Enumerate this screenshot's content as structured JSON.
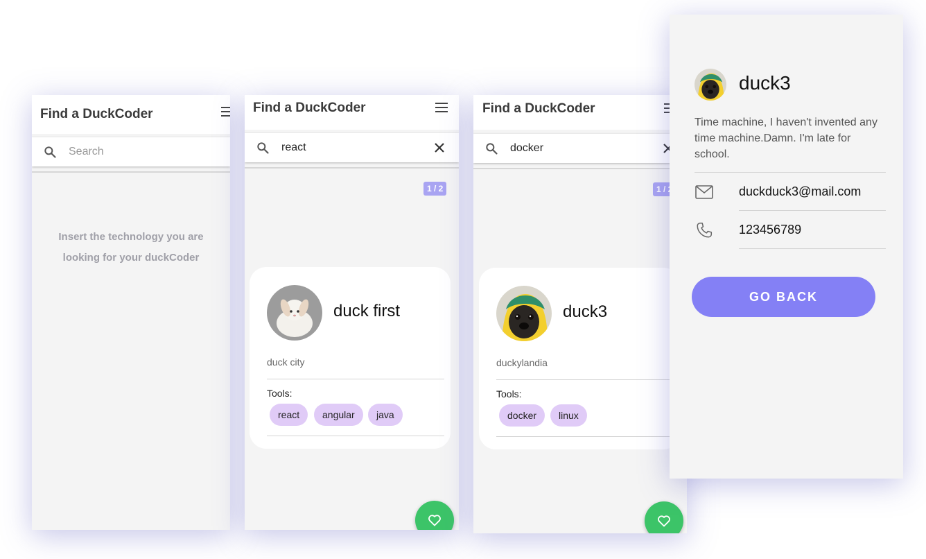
{
  "app": {
    "title": "Find a DuckCoder"
  },
  "screen1": {
    "search_placeholder": "Search",
    "empty_message_line1": "Insert the technology you are",
    "empty_message_line2": "looking for your duckCoder"
  },
  "screen2": {
    "search_value": "react",
    "pager": "1 / 2",
    "card": {
      "name": "duck first",
      "location": "duck city",
      "tools_label": "Tools:",
      "tools": [
        "react",
        "angular",
        "java"
      ]
    }
  },
  "screen3": {
    "search_value": "docker",
    "pager": "1 / 2",
    "card": {
      "name": "duck3",
      "location": "duckylandia",
      "tools_label": "Tools:",
      "tools": [
        "docker",
        "linux"
      ]
    }
  },
  "detail": {
    "name": "duck3",
    "bio": "Time machine, I haven't invented any time machine.Damn. I'm late for school.",
    "email": "duckduck3@mail.com",
    "phone": "123456789",
    "go_back_label": "GO BACK"
  },
  "icons": {
    "search": "search-icon",
    "menu": "menu-icon",
    "clear": "close-icon",
    "favorite": "heart-icon",
    "email": "mail-icon",
    "phone": "phone-icon"
  },
  "colors": {
    "accent": "#8480f5",
    "fab": "#3cc468",
    "chip": "#e0cbf7",
    "pager": "#a9a4f2",
    "background": "#f4f4f4"
  }
}
